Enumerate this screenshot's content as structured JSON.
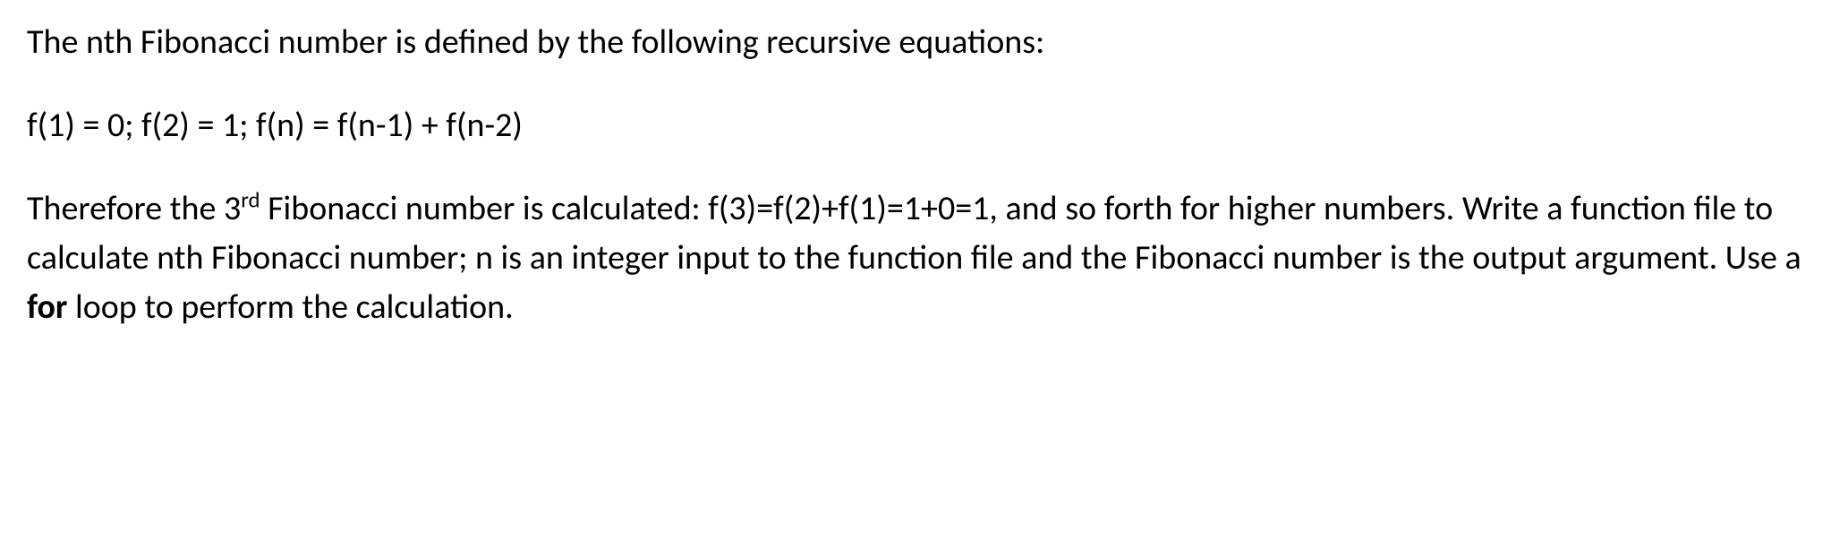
{
  "para1": "The nth Fibonacci number is defined by the following recursive equations:",
  "para2": "f(1) = 0;  f(2) = 1; f(n) = f(n-1) + f(n-2)",
  "para3": {
    "pre_sup": "Therefore the 3",
    "sup": "rd",
    "post_sup_before_bold": " Fibonacci number is calculated: f(3)=f(2)+f(1)=1+0=1, and so forth for higher numbers.  Write a function file to calculate nth Fibonacci number; n is an integer input to the function file and the Fibonacci number is the output argument.  Use a ",
    "bold": "for",
    "after_bold": " loop to perform the calculation."
  }
}
